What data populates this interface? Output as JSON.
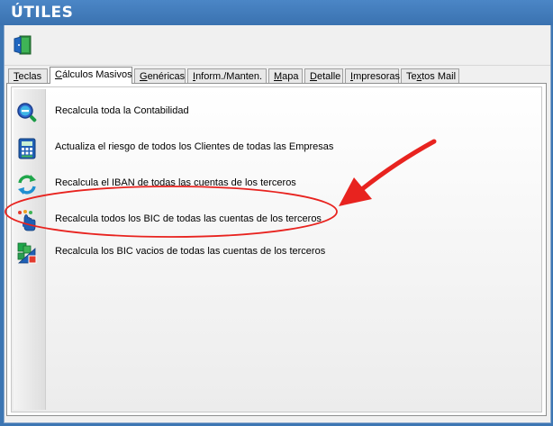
{
  "window": {
    "title": "ÚTILES"
  },
  "toolbar": {
    "exit_icon": "exit-door-icon"
  },
  "tabs": [
    {
      "label": "Teclas",
      "accel": "T",
      "rest": "eclas"
    },
    {
      "label": "Cálculos Masivos",
      "accel": "C",
      "rest": "álculos Masivos",
      "active": true
    },
    {
      "label": "Genéricas",
      "accel": "G",
      "rest": "enéricas"
    },
    {
      "label": "Inform./Manten.",
      "accel": "I",
      "rest": "nform./Manten."
    },
    {
      "label": "Mapa",
      "accel": "M",
      "rest": "apa"
    },
    {
      "label": "Detalle",
      "accel": "D",
      "rest": "etalle"
    },
    {
      "label": "Impresoras",
      "accel": "I",
      "rest": "mpresoras"
    },
    {
      "label": "Textos Mail",
      "accel": "x",
      "pre": "Te",
      "rest": "tos Mail"
    }
  ],
  "actions": [
    {
      "label": "Recalcula toda la Contabilidad",
      "icon": "magnifier-minus-icon"
    },
    {
      "label": "Actualiza el riesgo de todos los Clientes de todas las Empresas",
      "icon": "calculator-icon"
    },
    {
      "label": "Recalcula el IBAN de todas las cuentas de los terceros",
      "icon": "refresh-arrows-icon"
    },
    {
      "label": "Recalcula todos los BIC de todas las cuentas de los terceros",
      "icon": "hand-pointer-icon"
    },
    {
      "label": "Recalcula los BIC vacios de todas las cuentas de los terceros",
      "icon": "bic-blocks-icon"
    }
  ],
  "colors": {
    "titlebar": "#3d76b3",
    "highlight": "#e8231f",
    "accent_green": "#1fa64a",
    "accent_blue": "#1f5fb5"
  }
}
